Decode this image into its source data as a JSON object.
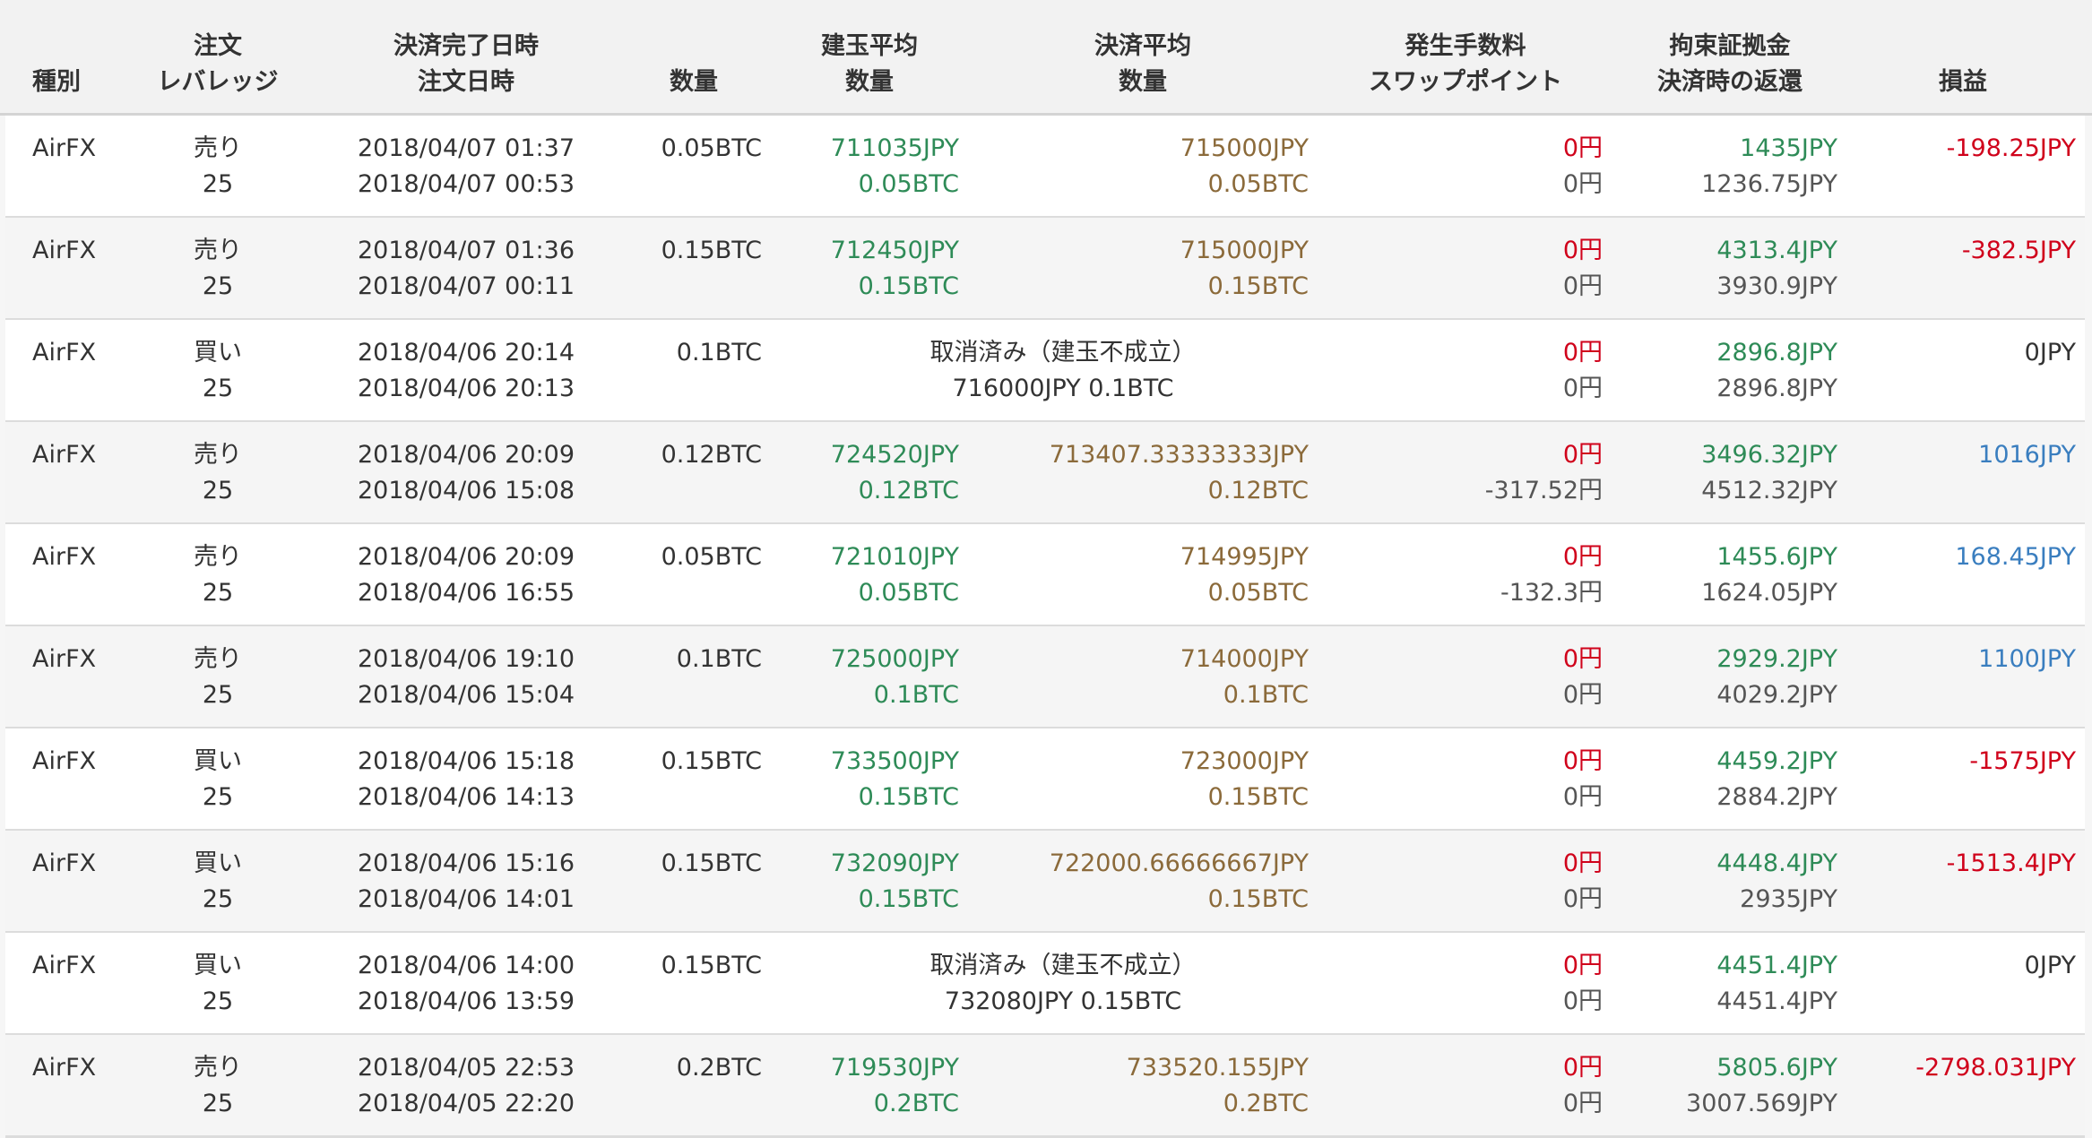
{
  "colors": {
    "positive": "#3a7ebf",
    "negative": "#d0021b",
    "open_price": "#2e8b57",
    "close_price": "#8b6a3a",
    "fee": "#d0021b"
  },
  "headers": {
    "type": {
      "line1": "",
      "line2": "種別"
    },
    "order": {
      "line1": "注文",
      "line2": "レバレッジ"
    },
    "datetime": {
      "line1": "決済完了日時",
      "line2": "注文日時"
    },
    "qty": {
      "line1": "",
      "line2": "数量"
    },
    "open": {
      "line1": "建玉平均",
      "line2": "数量"
    },
    "close": {
      "line1": "決済平均",
      "line2": "数量"
    },
    "fee": {
      "line1": "発生手数料",
      "line2": "スワップポイント"
    },
    "margin": {
      "line1": "拘束証拠金",
      "line2": "決済時の返還"
    },
    "pnl": {
      "line1": "",
      "line2": "損益"
    }
  },
  "rows": [
    {
      "type": "AirFX",
      "side": "売り",
      "leverage": "25",
      "settled": "2018/04/07 01:37",
      "ordered": "2018/04/07 00:53",
      "qty": "0.05BTC",
      "cancelled": false,
      "open_price": "711035JPY",
      "open_qty": "0.05BTC",
      "close_price": "715000JPY",
      "close_qty": "0.05BTC",
      "fee": "0円",
      "swap": "0円",
      "margin": "1435JPY",
      "returned": "1236.75JPY",
      "pnl": "-198.25JPY",
      "pnl_sign": "neg"
    },
    {
      "type": "AirFX",
      "side": "売り",
      "leverage": "25",
      "settled": "2018/04/07 01:36",
      "ordered": "2018/04/07 00:11",
      "qty": "0.15BTC",
      "cancelled": false,
      "open_price": "712450JPY",
      "open_qty": "0.15BTC",
      "close_price": "715000JPY",
      "close_qty": "0.15BTC",
      "fee": "0円",
      "swap": "0円",
      "margin": "4313.4JPY",
      "returned": "3930.9JPY",
      "pnl": "-382.5JPY",
      "pnl_sign": "neg"
    },
    {
      "type": "AirFX",
      "side": "買い",
      "leverage": "25",
      "settled": "2018/04/06 20:14",
      "ordered": "2018/04/06 20:13",
      "qty": "0.1BTC",
      "cancelled": true,
      "cancel_text": "取消済み（建玉不成立）",
      "cancel_detail": "716000JPY 0.1BTC",
      "fee": "0円",
      "swap": "0円",
      "margin": "2896.8JPY",
      "returned": "2896.8JPY",
      "pnl": "0JPY",
      "pnl_sign": "zero"
    },
    {
      "type": "AirFX",
      "side": "売り",
      "leverage": "25",
      "settled": "2018/04/06 20:09",
      "ordered": "2018/04/06 15:08",
      "qty": "0.12BTC",
      "cancelled": false,
      "open_price": "724520JPY",
      "open_qty": "0.12BTC",
      "close_price": "713407.33333333JPY",
      "close_qty": "0.12BTC",
      "fee": "0円",
      "swap": "-317.52円",
      "margin": "3496.32JPY",
      "returned": "4512.32JPY",
      "pnl": "1016JPY",
      "pnl_sign": "pos"
    },
    {
      "type": "AirFX",
      "side": "売り",
      "leverage": "25",
      "settled": "2018/04/06 20:09",
      "ordered": "2018/04/06 16:55",
      "qty": "0.05BTC",
      "cancelled": false,
      "open_price": "721010JPY",
      "open_qty": "0.05BTC",
      "close_price": "714995JPY",
      "close_qty": "0.05BTC",
      "fee": "0円",
      "swap": "-132.3円",
      "margin": "1455.6JPY",
      "returned": "1624.05JPY",
      "pnl": "168.45JPY",
      "pnl_sign": "pos"
    },
    {
      "type": "AirFX",
      "side": "売り",
      "leverage": "25",
      "settled": "2018/04/06 19:10",
      "ordered": "2018/04/06 15:04",
      "qty": "0.1BTC",
      "cancelled": false,
      "open_price": "725000JPY",
      "open_qty": "0.1BTC",
      "close_price": "714000JPY",
      "close_qty": "0.1BTC",
      "fee": "0円",
      "swap": "0円",
      "margin": "2929.2JPY",
      "returned": "4029.2JPY",
      "pnl": "1100JPY",
      "pnl_sign": "pos"
    },
    {
      "type": "AirFX",
      "side": "買い",
      "leverage": "25",
      "settled": "2018/04/06 15:18",
      "ordered": "2018/04/06 14:13",
      "qty": "0.15BTC",
      "cancelled": false,
      "open_price": "733500JPY",
      "open_qty": "0.15BTC",
      "close_price": "723000JPY",
      "close_qty": "0.15BTC",
      "fee": "0円",
      "swap": "0円",
      "margin": "4459.2JPY",
      "returned": "2884.2JPY",
      "pnl": "-1575JPY",
      "pnl_sign": "neg"
    },
    {
      "type": "AirFX",
      "side": "買い",
      "leverage": "25",
      "settled": "2018/04/06 15:16",
      "ordered": "2018/04/06 14:01",
      "qty": "0.15BTC",
      "cancelled": false,
      "open_price": "732090JPY",
      "open_qty": "0.15BTC",
      "close_price": "722000.66666667JPY",
      "close_qty": "0.15BTC",
      "fee": "0円",
      "swap": "0円",
      "margin": "4448.4JPY",
      "returned": "2935JPY",
      "pnl": "-1513.4JPY",
      "pnl_sign": "neg"
    },
    {
      "type": "AirFX",
      "side": "買い",
      "leverage": "25",
      "settled": "2018/04/06 14:00",
      "ordered": "2018/04/06 13:59",
      "qty": "0.15BTC",
      "cancelled": true,
      "cancel_text": "取消済み（建玉不成立）",
      "cancel_detail": "732080JPY 0.15BTC",
      "fee": "0円",
      "swap": "0円",
      "margin": "4451.4JPY",
      "returned": "4451.4JPY",
      "pnl": "0JPY",
      "pnl_sign": "zero"
    },
    {
      "type": "AirFX",
      "side": "売り",
      "leverage": "25",
      "settled": "2018/04/05 22:53",
      "ordered": "2018/04/05 22:20",
      "qty": "0.2BTC",
      "cancelled": false,
      "open_price": "719530JPY",
      "open_qty": "0.2BTC",
      "close_price": "733520.155JPY",
      "close_qty": "0.2BTC",
      "fee": "0円",
      "swap": "0円",
      "margin": "5805.6JPY",
      "returned": "3007.569JPY",
      "pnl": "-2798.031JPY",
      "pnl_sign": "neg"
    }
  ]
}
